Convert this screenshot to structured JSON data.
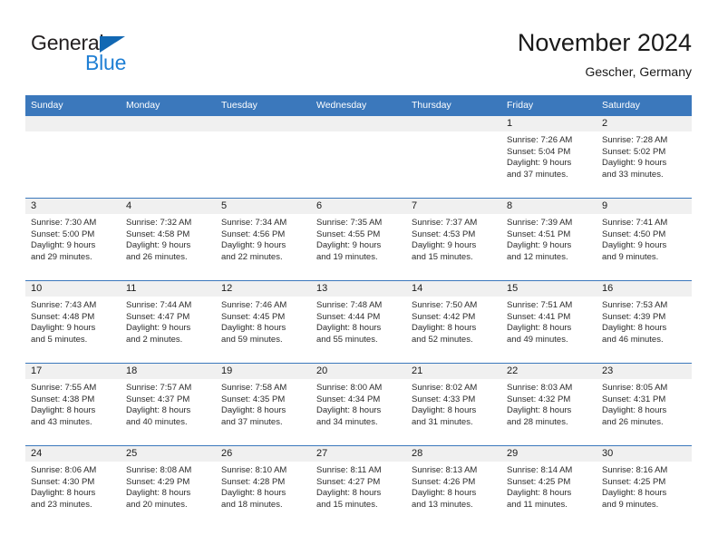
{
  "brand": {
    "name_part1": "General",
    "name_part2": "Blue",
    "accent_color": "#1f7fd4",
    "triangle_color": "#1268b3"
  },
  "header": {
    "title": "November 2024",
    "subtitle": "Gescher, Germany"
  },
  "theme": {
    "header_row_bg": "#3b78bc",
    "daynum_strip_bg": "#f0f0f0",
    "grid_line": "#3b78bc",
    "text": "#1a1a1a"
  },
  "weekday_headers": [
    "Sunday",
    "Monday",
    "Tuesday",
    "Wednesday",
    "Thursday",
    "Friday",
    "Saturday"
  ],
  "labels": {
    "sunrise_prefix": "Sunrise:",
    "sunset_prefix": "Sunset:",
    "daylight_prefix": "Daylight:"
  },
  "weeks": [
    [
      {
        "day": "",
        "empty": true
      },
      {
        "day": "",
        "empty": true
      },
      {
        "day": "",
        "empty": true
      },
      {
        "day": "",
        "empty": true
      },
      {
        "day": "",
        "empty": true
      },
      {
        "day": "1",
        "line1": "Sunrise: 7:26 AM",
        "line2": "Sunset: 5:04 PM",
        "line3": "Daylight: 9 hours",
        "line4": "and 37 minutes."
      },
      {
        "day": "2",
        "line1": "Sunrise: 7:28 AM",
        "line2": "Sunset: 5:02 PM",
        "line3": "Daylight: 9 hours",
        "line4": "and 33 minutes."
      }
    ],
    [
      {
        "day": "3",
        "line1": "Sunrise: 7:30 AM",
        "line2": "Sunset: 5:00 PM",
        "line3": "Daylight: 9 hours",
        "line4": "and 29 minutes."
      },
      {
        "day": "4",
        "line1": "Sunrise: 7:32 AM",
        "line2": "Sunset: 4:58 PM",
        "line3": "Daylight: 9 hours",
        "line4": "and 26 minutes."
      },
      {
        "day": "5",
        "line1": "Sunrise: 7:34 AM",
        "line2": "Sunset: 4:56 PM",
        "line3": "Daylight: 9 hours",
        "line4": "and 22 minutes."
      },
      {
        "day": "6",
        "line1": "Sunrise: 7:35 AM",
        "line2": "Sunset: 4:55 PM",
        "line3": "Daylight: 9 hours",
        "line4": "and 19 minutes."
      },
      {
        "day": "7",
        "line1": "Sunrise: 7:37 AM",
        "line2": "Sunset: 4:53 PM",
        "line3": "Daylight: 9 hours",
        "line4": "and 15 minutes."
      },
      {
        "day": "8",
        "line1": "Sunrise: 7:39 AM",
        "line2": "Sunset: 4:51 PM",
        "line3": "Daylight: 9 hours",
        "line4": "and 12 minutes."
      },
      {
        "day": "9",
        "line1": "Sunrise: 7:41 AM",
        "line2": "Sunset: 4:50 PM",
        "line3": "Daylight: 9 hours",
        "line4": "and 9 minutes."
      }
    ],
    [
      {
        "day": "10",
        "line1": "Sunrise: 7:43 AM",
        "line2": "Sunset: 4:48 PM",
        "line3": "Daylight: 9 hours",
        "line4": "and 5 minutes."
      },
      {
        "day": "11",
        "line1": "Sunrise: 7:44 AM",
        "line2": "Sunset: 4:47 PM",
        "line3": "Daylight: 9 hours",
        "line4": "and 2 minutes."
      },
      {
        "day": "12",
        "line1": "Sunrise: 7:46 AM",
        "line2": "Sunset: 4:45 PM",
        "line3": "Daylight: 8 hours",
        "line4": "and 59 minutes."
      },
      {
        "day": "13",
        "line1": "Sunrise: 7:48 AM",
        "line2": "Sunset: 4:44 PM",
        "line3": "Daylight: 8 hours",
        "line4": "and 55 minutes."
      },
      {
        "day": "14",
        "line1": "Sunrise: 7:50 AM",
        "line2": "Sunset: 4:42 PM",
        "line3": "Daylight: 8 hours",
        "line4": "and 52 minutes."
      },
      {
        "day": "15",
        "line1": "Sunrise: 7:51 AM",
        "line2": "Sunset: 4:41 PM",
        "line3": "Daylight: 8 hours",
        "line4": "and 49 minutes."
      },
      {
        "day": "16",
        "line1": "Sunrise: 7:53 AM",
        "line2": "Sunset: 4:39 PM",
        "line3": "Daylight: 8 hours",
        "line4": "and 46 minutes."
      }
    ],
    [
      {
        "day": "17",
        "line1": "Sunrise: 7:55 AM",
        "line2": "Sunset: 4:38 PM",
        "line3": "Daylight: 8 hours",
        "line4": "and 43 minutes."
      },
      {
        "day": "18",
        "line1": "Sunrise: 7:57 AM",
        "line2": "Sunset: 4:37 PM",
        "line3": "Daylight: 8 hours",
        "line4": "and 40 minutes."
      },
      {
        "day": "19",
        "line1": "Sunrise: 7:58 AM",
        "line2": "Sunset: 4:35 PM",
        "line3": "Daylight: 8 hours",
        "line4": "and 37 minutes."
      },
      {
        "day": "20",
        "line1": "Sunrise: 8:00 AM",
        "line2": "Sunset: 4:34 PM",
        "line3": "Daylight: 8 hours",
        "line4": "and 34 minutes."
      },
      {
        "day": "21",
        "line1": "Sunrise: 8:02 AM",
        "line2": "Sunset: 4:33 PM",
        "line3": "Daylight: 8 hours",
        "line4": "and 31 minutes."
      },
      {
        "day": "22",
        "line1": "Sunrise: 8:03 AM",
        "line2": "Sunset: 4:32 PM",
        "line3": "Daylight: 8 hours",
        "line4": "and 28 minutes."
      },
      {
        "day": "23",
        "line1": "Sunrise: 8:05 AM",
        "line2": "Sunset: 4:31 PM",
        "line3": "Daylight: 8 hours",
        "line4": "and 26 minutes."
      }
    ],
    [
      {
        "day": "24",
        "line1": "Sunrise: 8:06 AM",
        "line2": "Sunset: 4:30 PM",
        "line3": "Daylight: 8 hours",
        "line4": "and 23 minutes."
      },
      {
        "day": "25",
        "line1": "Sunrise: 8:08 AM",
        "line2": "Sunset: 4:29 PM",
        "line3": "Daylight: 8 hours",
        "line4": "and 20 minutes."
      },
      {
        "day": "26",
        "line1": "Sunrise: 8:10 AM",
        "line2": "Sunset: 4:28 PM",
        "line3": "Daylight: 8 hours",
        "line4": "and 18 minutes."
      },
      {
        "day": "27",
        "line1": "Sunrise: 8:11 AM",
        "line2": "Sunset: 4:27 PM",
        "line3": "Daylight: 8 hours",
        "line4": "and 15 minutes."
      },
      {
        "day": "28",
        "line1": "Sunrise: 8:13 AM",
        "line2": "Sunset: 4:26 PM",
        "line3": "Daylight: 8 hours",
        "line4": "and 13 minutes."
      },
      {
        "day": "29",
        "line1": "Sunrise: 8:14 AM",
        "line2": "Sunset: 4:25 PM",
        "line3": "Daylight: 8 hours",
        "line4": "and 11 minutes."
      },
      {
        "day": "30",
        "line1": "Sunrise: 8:16 AM",
        "line2": "Sunset: 4:25 PM",
        "line3": "Daylight: 8 hours",
        "line4": "and 9 minutes."
      }
    ]
  ]
}
